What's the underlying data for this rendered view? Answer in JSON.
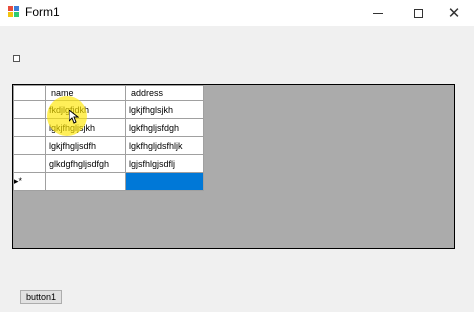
{
  "window": {
    "title": "Form1",
    "controls": {
      "minimize_icon": "minimize-icon",
      "maximize_icon": "maximize-icon",
      "close_glyph": "✕"
    }
  },
  "grid": {
    "columns": [
      "name",
      "address"
    ],
    "rows": [
      [
        "fkdjlgfjdkh",
        "lgkjfhglsjkh"
      ],
      [
        "lgkjfhgljsjkh",
        "lgkfhgljsfdgh"
      ],
      [
        "lgkjfhgljsdfh",
        "lgkfhgljdsfhljk"
      ],
      [
        "glkdgfhgljsdfgh",
        "lgjsfhlgjsdflj"
      ]
    ],
    "new_row_marker": "▸*",
    "selection_color": "#0078d7"
  },
  "button1": {
    "label": "button1"
  }
}
